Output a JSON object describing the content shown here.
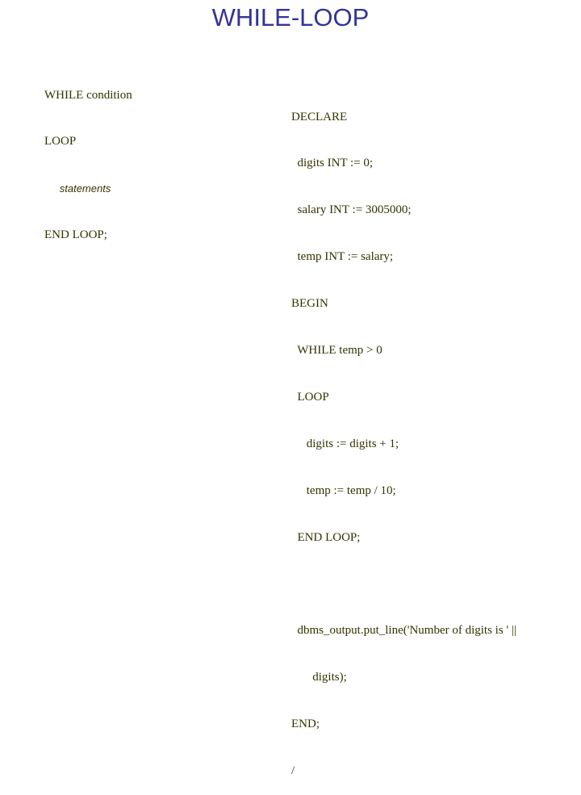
{
  "slide": {
    "title": "WHILE-LOOP",
    "syntax": {
      "line1_keyword": "WHILE",
      "line1_rest": " condition",
      "line2": "LOOP",
      "line3_indent": "     ",
      "line3_italic": "statements",
      "line4": "END LOOP;"
    },
    "example": {
      "lines": [
        "DECLARE",
        "  digits INT := 0;",
        "  salary INT := 3005000;",
        "  temp INT := salary;",
        "BEGIN",
        "  WHILE temp > 0",
        "  LOOP",
        "     digits := digits + 1;",
        "     temp := temp / 10;",
        "  END LOOP;",
        "",
        "  dbms_output.put_line('Number of digits is ' ||",
        "       digits);",
        "END;",
        "/"
      ]
    }
  },
  "colors": {
    "title": "#333399",
    "text": "#333300",
    "background": "#ffffff"
  }
}
